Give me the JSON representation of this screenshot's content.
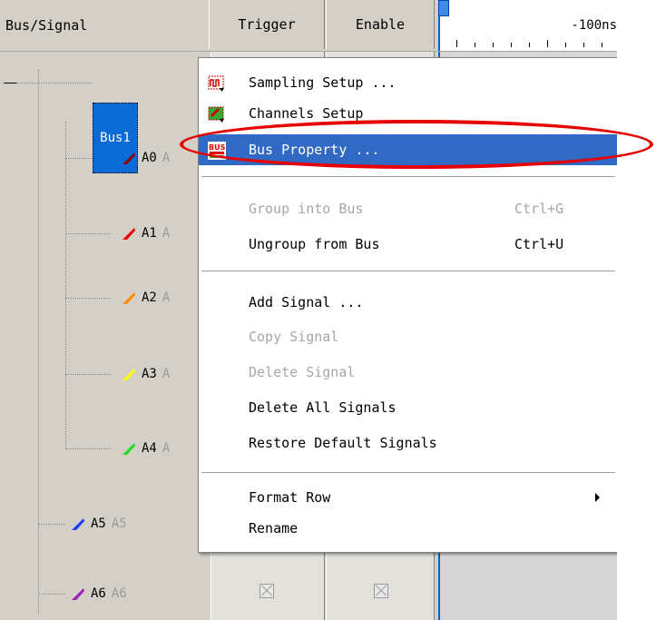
{
  "header": {
    "bus_signal": "Bus/Signal",
    "trigger": "Trigger",
    "enable": "Enable",
    "time_label": "-100ns"
  },
  "tree": {
    "bus_label": "Bus1",
    "signals": [
      {
        "name": "A0",
        "alias": "A",
        "color": "#8b0000"
      },
      {
        "name": "A1",
        "alias": "A",
        "color": "#e60000"
      },
      {
        "name": "A2",
        "alias": "A",
        "color": "#ff8c00"
      },
      {
        "name": "A3",
        "alias": "A",
        "color": "#ffff00"
      },
      {
        "name": "A4",
        "alias": "A",
        "color": "#22dd22"
      },
      {
        "name": "A5",
        "alias": "A5",
        "color": "#1e3cff"
      },
      {
        "name": "A6",
        "alias": "A6",
        "color": "#9b1fb8"
      }
    ]
  },
  "context_menu": {
    "items": [
      {
        "label": "Sampling Setup ...",
        "icon": "sampling-setup-icon"
      },
      {
        "label": "Channels Setup",
        "icon": "channels-setup-icon"
      },
      {
        "label": "Bus Property ...",
        "icon": "bus-property-icon",
        "highlighted": true
      },
      {
        "label": "Group into Bus",
        "shortcut": "Ctrl+G",
        "disabled": true
      },
      {
        "label": "Ungroup from Bus",
        "shortcut": "Ctrl+U"
      },
      {
        "label": "Add Signal ..."
      },
      {
        "label": "Copy Signal",
        "disabled": true
      },
      {
        "label": "Delete Signal",
        "disabled": true
      },
      {
        "label": "Delete All Signals"
      },
      {
        "label": "Restore Default Signals"
      },
      {
        "label": "Format Row",
        "submenu": true
      },
      {
        "label": "Rename"
      }
    ],
    "icon_text_bus": "BUS"
  },
  "colors": {
    "highlight": "#316ac5",
    "bus_node": "#0a6ad6",
    "annotation": "#e60000"
  }
}
